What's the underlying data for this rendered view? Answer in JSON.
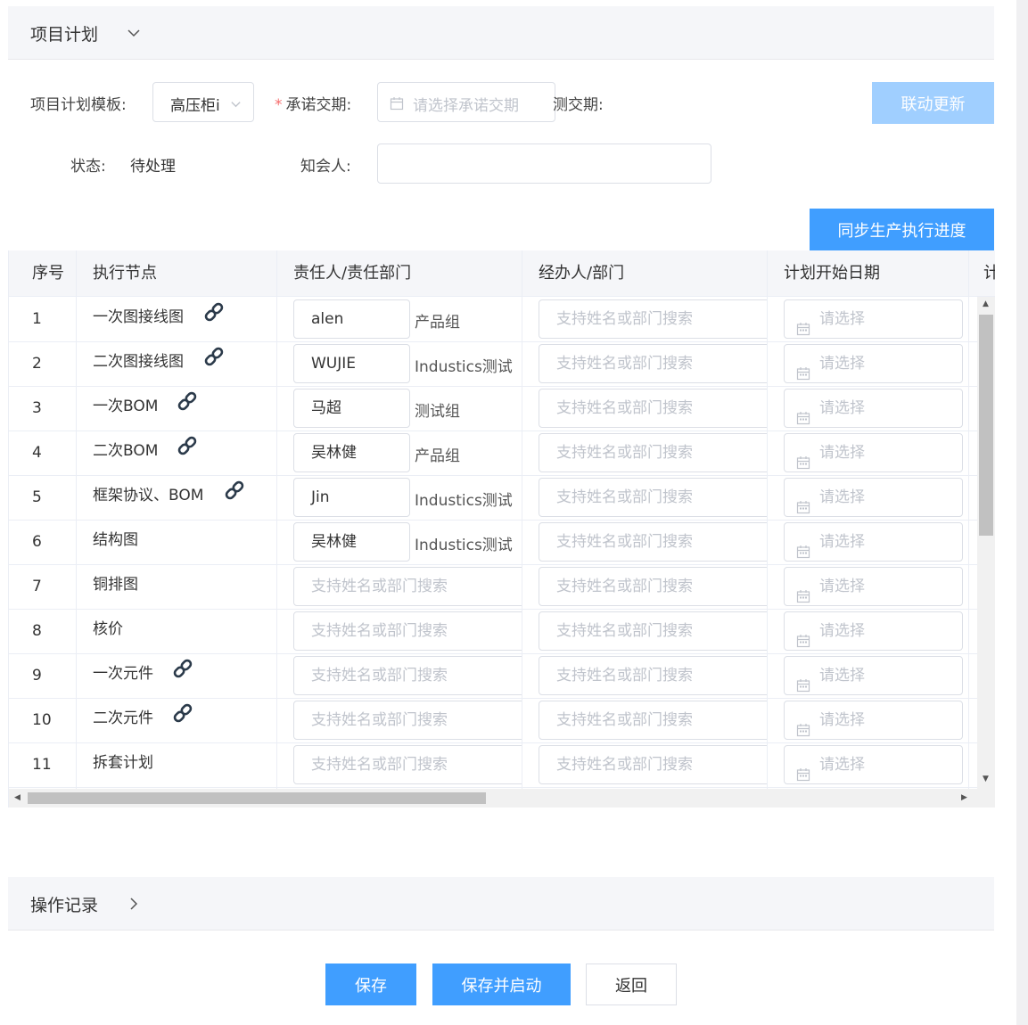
{
  "plan_section": {
    "title": "项目计划"
  },
  "form": {
    "template_label": "项目计划模板:",
    "template_value": "高压柜i",
    "promise_label": "承诺交期:",
    "promise_placeholder": "请选择承诺交期",
    "predict_label": "测交期:",
    "link_update_button": "联动更新",
    "status_label": "状态:",
    "status_value": "待处理",
    "notify_label": "知会人:"
  },
  "sync_button": "同步生产执行进度",
  "table": {
    "headers": [
      "序号",
      "执行节点",
      "责任人/责任部门",
      "经办人/部门",
      "计划开始日期",
      "计"
    ],
    "search_placeholder": "支持姓名或部门搜索",
    "date_placeholder": "请选择",
    "rows": [
      {
        "idx": "1",
        "node": "一次图接线图",
        "link": true,
        "person": "alen",
        "dept": "产品组"
      },
      {
        "idx": "2",
        "node": "二次图接线图",
        "link": true,
        "person": "WUJIE",
        "dept": "Industics测试"
      },
      {
        "idx": "3",
        "node": "一次BOM",
        "link": true,
        "person": "马超",
        "dept": "测试组"
      },
      {
        "idx": "4",
        "node": "二次BOM",
        "link": true,
        "person": "吴林健",
        "dept": "产品组"
      },
      {
        "idx": "5",
        "node": "框架协议、BOM",
        "link": true,
        "person": "Jin",
        "dept": "Industics测试"
      },
      {
        "idx": "6",
        "node": "结构图",
        "link": false,
        "person": "吴林健",
        "dept": "Industics测试"
      },
      {
        "idx": "7",
        "node": "铜排图",
        "link": false,
        "person": "",
        "dept": ""
      },
      {
        "idx": "8",
        "node": "核价",
        "link": false,
        "person": "",
        "dept": ""
      },
      {
        "idx": "9",
        "node": "一次元件",
        "link": true,
        "person": "",
        "dept": ""
      },
      {
        "idx": "10",
        "node": "二次元件",
        "link": true,
        "person": "",
        "dept": ""
      },
      {
        "idx": "11",
        "node": "拆套计划",
        "link": false,
        "person": "",
        "dept": ""
      }
    ]
  },
  "log_section": {
    "title": "操作记录"
  },
  "footer": {
    "save": "保存",
    "save_start": "保存并启动",
    "back": "返回"
  },
  "colors": {
    "primary": "#409eff",
    "primary_light": "#a0cfff",
    "required": "#f56c6c"
  }
}
